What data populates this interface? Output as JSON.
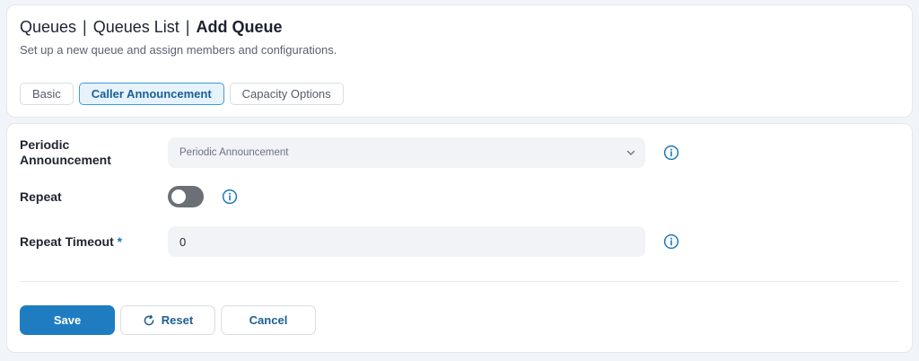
{
  "header": {
    "breadcrumb": [
      "Queues",
      "Queues List",
      "Add Queue"
    ],
    "subtitle": "Set up a new queue and assign members and configurations."
  },
  "tabs": [
    {
      "label": "Basic",
      "active": false
    },
    {
      "label": "Caller Announcement",
      "active": true
    },
    {
      "label": "Capacity Options",
      "active": false
    }
  ],
  "form": {
    "periodic_announcement": {
      "label_line1": "Periodic",
      "label_line2": "Announcement",
      "placeholder": "Periodic Announcement",
      "icon": "chevron-down-icon"
    },
    "repeat": {
      "label": "Repeat",
      "enabled": false
    },
    "repeat_timeout": {
      "label": "Repeat Timeout",
      "required_marker": "*",
      "value": "0"
    }
  },
  "actions": {
    "save_label": "Save",
    "reset_label": "Reset",
    "cancel_label": "Cancel"
  },
  "colors": {
    "primary": "#1f7cc1",
    "info_icon": "#1a78b8",
    "toggle_off": "#6b6f76",
    "active_tab_bg": "#e6f3fc"
  }
}
